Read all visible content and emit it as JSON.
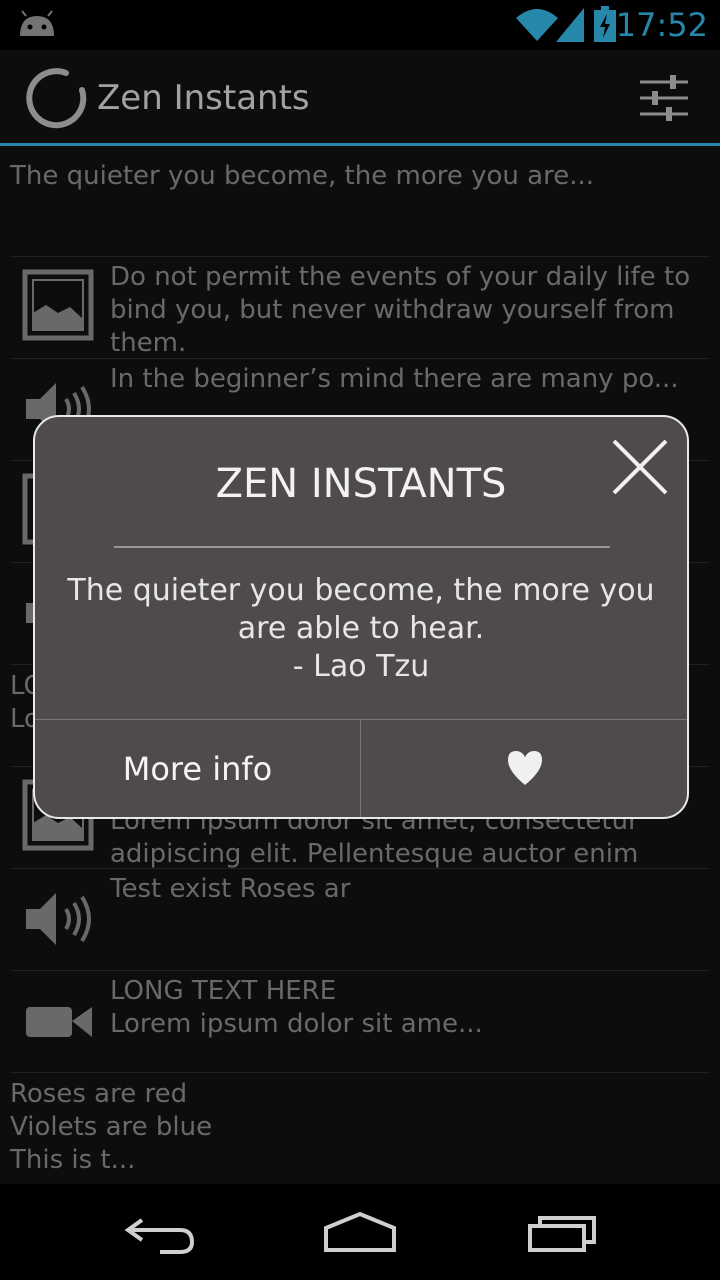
{
  "status_bar": {
    "time": "17:52"
  },
  "action_bar": {
    "title": "Zen Instants"
  },
  "list": {
    "header_text": "The quieter you become, the more you are...",
    "items": [
      {
        "type": "image",
        "text": "Do not permit the events of your daily life to bind you, but never withdraw yourself from them."
      },
      {
        "type": "audio",
        "text": "In the beginner’s mind there are many po..."
      },
      {
        "type": "image",
        "text": ""
      },
      {
        "type": "audio",
        "text": ""
      }
    ],
    "partial_row": {
      "line1": "LO",
      "line2": "Lo"
    },
    "items2": [
      {
        "type": "image",
        "text": "Lorem ipsum dolor sit amet, consectetur adipiscing elit. Pellentesque auctor enim"
      },
      {
        "type": "audio",
        "text": "Test exist Roses ar"
      },
      {
        "type": "video",
        "text": "LONG TEXT HERE\nLorem ipsum dolor sit ame..."
      }
    ],
    "footer_text": "Roses are red\nViolets are blue\nThis is t..."
  },
  "dialog": {
    "title": "ZEN INSTANTS",
    "message": "The quieter you become, the more you are able to hear.",
    "author": "- Lao Tzu",
    "more_info_label": "More info"
  },
  "colors": {
    "accent": "#33b5e5",
    "dialog_bg": "#4f4a4d"
  }
}
